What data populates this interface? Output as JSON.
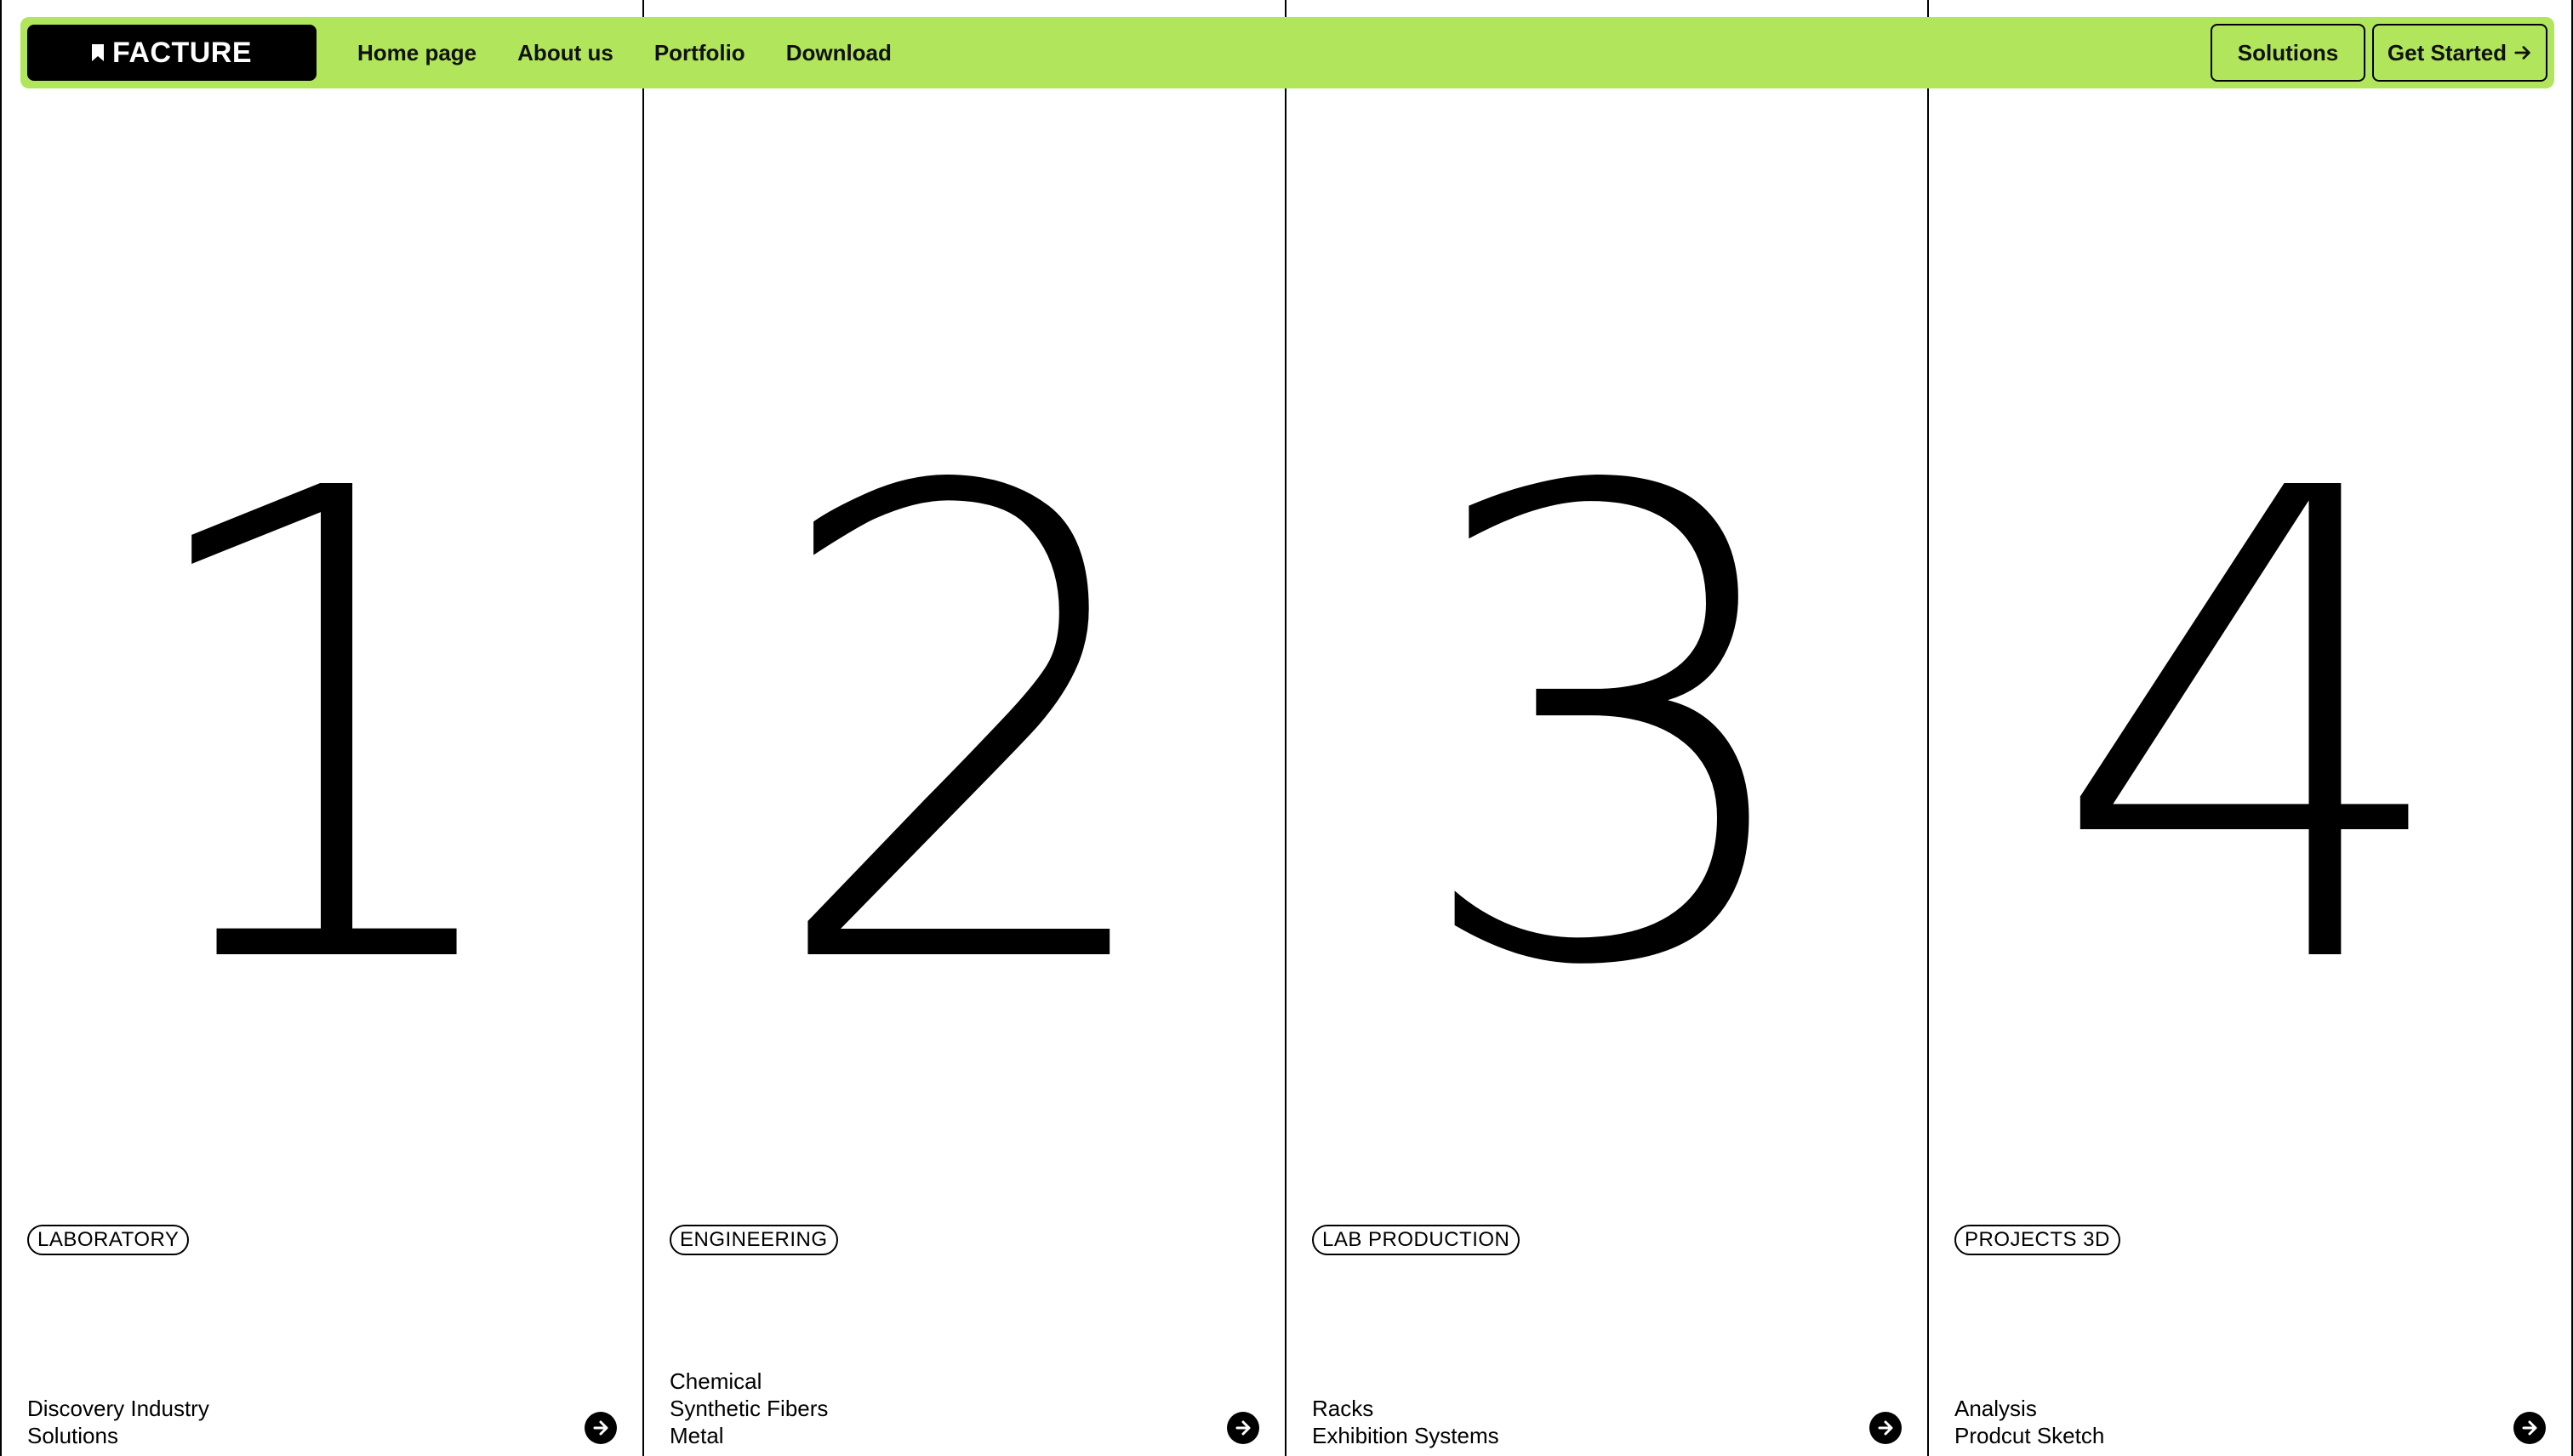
{
  "nav": {
    "logo": "FACTURE",
    "links": [
      "Home page",
      "About us",
      "Portfolio",
      "Download"
    ],
    "solutions_label": "Solutions",
    "get_started_label": "Get Started"
  },
  "columns": [
    {
      "number": "1",
      "tag": "LABORATORY",
      "lines": [
        "Discovery Industry",
        "Solutions"
      ]
    },
    {
      "number": "2",
      "tag": "ENGINEERING",
      "lines": [
        "Chemical",
        "Synthetic Fibers",
        "Metal"
      ]
    },
    {
      "number": "3",
      "tag": "LAB PRODUCTION",
      "lines": [
        "Racks",
        "Exhibition Systems"
      ]
    },
    {
      "number": "4",
      "tag": "PROJECTS 3D",
      "lines": [
        "Analysis",
        "Prodcut Sketch"
      ]
    }
  ],
  "colors": {
    "accent": "#b1e55b",
    "text": "#000000",
    "background": "#ffffff"
  },
  "icons": {
    "logo": "bookmark-icon",
    "column_link": "arrow-right-circle-icon",
    "cta": "arrow-right-icon"
  }
}
